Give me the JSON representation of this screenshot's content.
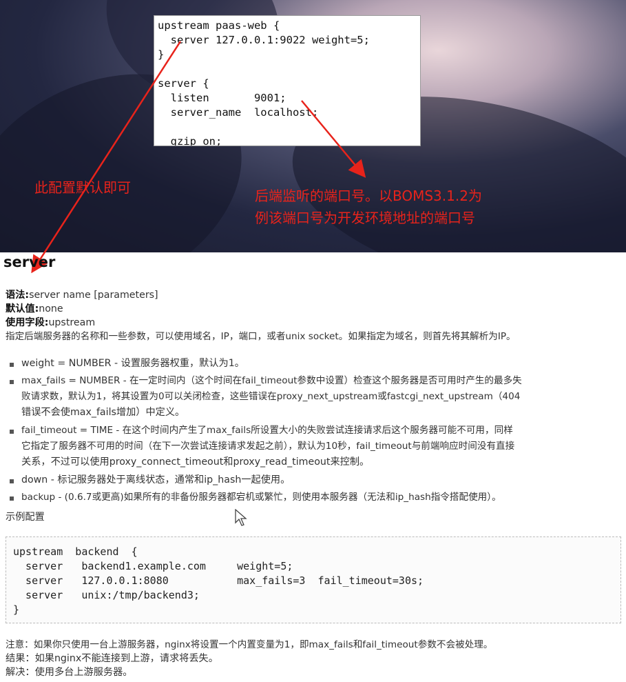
{
  "banner": {
    "snippet_lines": [
      "upstream paas-web {",
      "  server 127.0.0.1:9022 weight=5;",
      "}",
      "",
      "server {",
      "  listen       9001;",
      "  server_name  localhost;",
      "",
      "  gzip on;"
    ],
    "note_left": "此配置默认即可",
    "note_right_1": "后端监听的端口号。以BOMS3.1.2为",
    "note_right_2": "例该端口号为开发环境地址的端口号",
    "accent_color": "#e8231b"
  },
  "doc": {
    "title": "server",
    "syntax_label": "语法:",
    "syntax_value": "server name [parameters]",
    "default_label": "默认值:",
    "default_value": "none",
    "context_label": "使用字段:",
    "context_value": "upstream",
    "description": "指定后端服务器的名称和一些参数，可以使用域名，IP，端口，或者unix socket。如果指定为域名，则首先将其解析为IP。",
    "params": [
      {
        "lines": [
          "weight = NUMBER - 设置服务器权重，默认为1。"
        ]
      },
      {
        "lines": [
          "max_fails = NUMBER - 在一定时间内（这个时间在fail_timeout参数中设置）检查这个服务器是否可用时产生的最多失",
          "败请求数，默认为1，将其设置为0可以关闭检查，这些错误在proxy_next_upstream或fastcgi_next_upstream（404",
          "错误不会使max_fails增加）中定义。"
        ]
      },
      {
        "lines": [
          "fail_timeout = TIME - 在这个时间内产生了max_fails所设置大小的失败尝试连接请求后这个服务器可能不可用，同样",
          "它指定了服务器不可用的时间（在下一次尝试连接请求发起之前），默认为10秒，fail_timeout与前端响应时间没有直接",
          "关系，不过可以使用proxy_connect_timeout和proxy_read_timeout来控制。"
        ]
      },
      {
        "lines": [
          "down - 标记服务器处于离线状态，通常和ip_hash一起使用。"
        ]
      },
      {
        "lines": [
          "backup - (0.6.7或更高)如果所有的非备份服务器都宕机或繁忙，则使用本服务器（无法和ip_hash指令搭配使用）。"
        ]
      }
    ],
    "example_heading": "示例配置",
    "example_code": [
      "upstream  backend  {",
      "  server   backend1.example.com     weight=5;",
      "  server   127.0.0.1:8080           max_fails=3  fail_timeout=30s;",
      "  server   unix:/tmp/backend3;",
      "}"
    ],
    "footer": [
      "注意：如果你只使用一台上游服务器，nginx将设置一个内置变量为1，即max_fails和fail_timeout参数不会被处理。",
      "结果：如果nginx不能连接到上游，请求将丢失。",
      "解决：使用多台上游服务器。"
    ]
  }
}
